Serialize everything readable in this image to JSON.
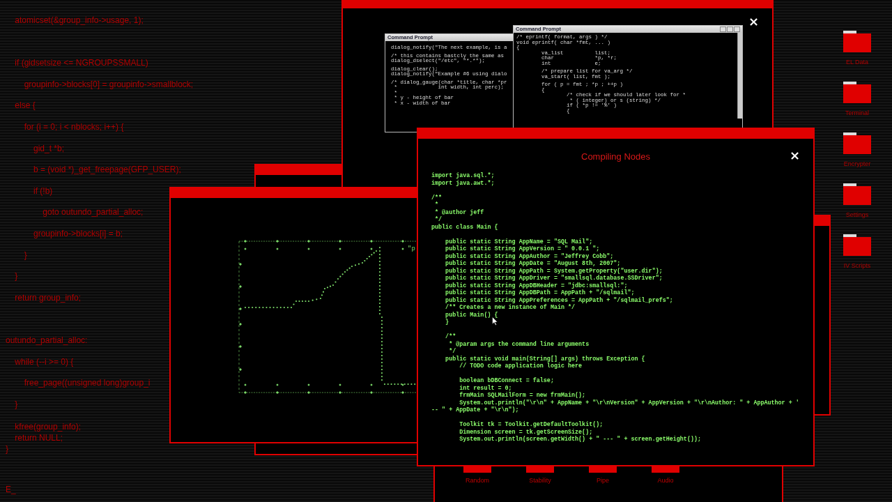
{
  "background_code": {
    "blocks": [
      {
        "kind": "spaced",
        "lines": [
          "    atomicset(&group_info->usage, 1);"
        ]
      },
      {
        "kind": "spaced",
        "lines": [
          "    if (gidsetsize <= NGROUPSSMALL)",
          "        groupinfo->blocks[0] = groupinfo->smallblock;",
          "    else {",
          "        for (i = 0; i < nblocks; i++) {",
          "            gid_t *b;",
          "            b = (void *)_get_freepage(GFP_USER);",
          "            if (!b)",
          "                goto outundo_partial_alloc;",
          "            groupinfo->blocks[i] = b;",
          "        }",
          "    }",
          "    return group_info;"
        ]
      },
      {
        "kind": "spaced",
        "lines": [
          "outundo_partial_alloc:",
          "    while (--i >= 0) {",
          "        free_page((unsigned long)group_i",
          "    }"
        ]
      },
      {
        "kind": "tight",
        "lines": [
          "    kfree(group_info);",
          "    return NULL;",
          "}"
        ]
      }
    ],
    "prompt": "E_"
  },
  "back_window": {
    "close": "×",
    "consoles": [
      {
        "title": "Command Prompt",
        "blocks": [
          [
            "dialog_notify(\"The next example, is a"
          ],
          [
            "/* this contains bastcly the same as",
            "dialog_dselect(\"/etc\", \"*.*\");"
          ],
          [
            "dialog_clear();",
            "dialog_notify(\"Example #6 using dialo"
          ],
          [
            "/* dialog_gauge(char *title, char *pr",
            " *             int width, int perc);",
            " *",
            " * y - height of bar",
            " * x - width of bar"
          ]
        ]
      },
      {
        "title": "Command Prompt",
        "blocks": [
          [
            "/* eprintf( format, args ) */",
            "void eprintf( char *fmt, ... )",
            "{",
            "        va_list          list;",
            "        char             *p, *r;",
            "        int              e;"
          ],
          [
            "        /* prepare list for va_arg */",
            "        va_start( list, fmt );"
          ],
          [
            "        for ( p = fmt ; *p ; ++p )",
            "        {",
            "                /* check if we should later look for *",
            "                 * ( integer) or s (string) */",
            "                if ( *p != '%' )",
            "                {"
          ]
        ]
      }
    ]
  },
  "graph_window": {
    "label": "\"p"
  },
  "main_window": {
    "title": "Compiling Nodes",
    "close": "×",
    "code_blocks": [
      [
        "import java.sql.*;",
        "import java.awt.*;"
      ],
      [
        "/**",
        " *",
        " * @author jeff",
        " */",
        "public class Main {"
      ],
      [
        "    public static String AppName = \"SQL Mail\";",
        "    public static String AppVersion = \" 0.0.1 \";",
        "    public static String AppAuthor = \"Jeffrey Cobb\";",
        "    public static String AppDate = \"August 8th, 2007\";",
        "    public static String AppPath = System.getProperty(\"user.dir\");",
        "    public static String AppDriver = \"smallsql.database.SSDriver\";",
        "    public static String AppDBHeader = \"jdbc:smallsql:\";",
        "    public static String AppDBPath = AppPath + \"/sqlmail\";",
        "    public static String AppPreferences = AppPath + \"/sqlmail_prefs\";",
        "    /** Creates a new instance of Main */",
        "    public Main() {",
        "    }"
      ],
      [
        "    /**",
        "     * @param args the command line arguments",
        "     */",
        "    public static void main(String[] args) throws Exception {",
        "        // TODO code application logic here"
      ],
      [
        "        boolean bDBConnect = false;",
        "        int result = 0;",
        "        frmMain SQLMailForm = new frmMain();",
        "        System.out.println(\"\\r\\n\" + AppName + \"\\r\\nVersion\" + AppVersion + \"\\r\\nAuthor: \" + AppAuthor + '",
        "-- \" + AppDate + \"\\r\\n\");"
      ],
      [
        "        Toolkit tk = Toolkit.getDefaultToolkit();",
        "        Dimension screen = tk.getScreenSize();",
        "        System.out.println(screen.getWidth() + \" --- \" + screen.getHeight());"
      ]
    ]
  },
  "bottom_buttons": [
    "Random",
    "Stability",
    "Pipe",
    "Audio"
  ],
  "desktop_folders": [
    "EL Data",
    "Terminal",
    "Encrypter",
    "Settings",
    "IV Scripts"
  ]
}
